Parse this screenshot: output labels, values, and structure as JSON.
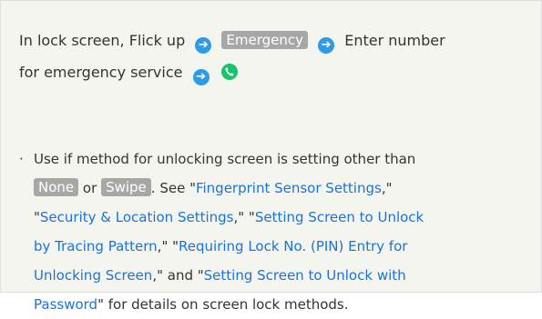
{
  "step": {
    "part1": "In lock screen, Flick up",
    "arrow": "➔",
    "emergency_key": "Emergency",
    "part2": "Enter number",
    "part3": "for emergency service"
  },
  "note": {
    "bullet": "·",
    "line1": "Use if method for unlocking screen is setting other than",
    "key_none": "None",
    "or": "or",
    "key_swipe": "Swipe",
    "see": ". See \"",
    "link1": "Fingerprint Sensor Settings",
    "sep1": ",\"",
    "q_open2": "\"",
    "link2": "Security & Location Settings",
    "sep2": ",\" \"",
    "link3a": "Setting Screen to Unlock",
    "link3b": "by Tracing Pattern",
    "sep3": ",\" \"",
    "link4a": "Requiring Lock No. (PIN) Entry for",
    "link4b": "Unlocking Screen",
    "sep4": ",\" and \"",
    "link5a": "Setting Screen to Unlock with",
    "link5b": "Password",
    "tail": "\" for details on screen lock methods."
  },
  "colors": {
    "arrow": "#2e9be8",
    "call": "#16c46a",
    "key_bg": "#a7a7a7",
    "link": "#1a73d9",
    "panel_bg": "#f5f5ef"
  },
  "icons": [
    "arrow-right-icon",
    "phone-call-icon"
  ]
}
